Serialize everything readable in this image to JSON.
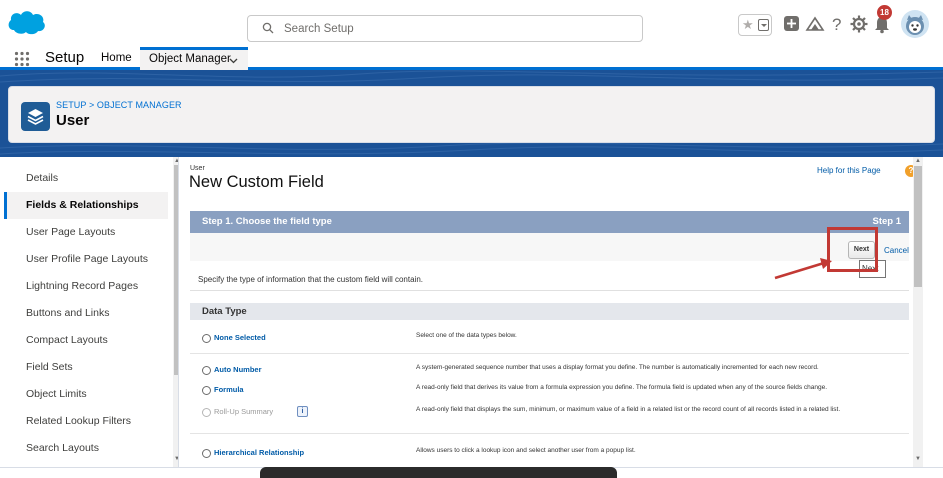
{
  "header": {
    "search": {
      "placeholder": "Search Setup"
    },
    "notification_count": "18",
    "colors": {
      "brand": "#00a1e0",
      "accent": "#0070d2",
      "badge": "#c23934"
    },
    "icons": [
      "salesforce-logo-icon",
      "star-icon",
      "add-icon",
      "trailhead-icon",
      "help-icon",
      "gear-icon",
      "bell-icon",
      "avatar-icon"
    ]
  },
  "app_nav": {
    "app_name": "Setup",
    "home": "Home",
    "object_manager": "Object Manager"
  },
  "page_header": {
    "breadcrumb": "SETUP > OBJECT MANAGER",
    "title": "User"
  },
  "sidebar": {
    "items": [
      {
        "label": "Details"
      },
      {
        "label": "Fields & Relationships",
        "active": true
      },
      {
        "label": "User Page Layouts"
      },
      {
        "label": "User Profile Page Layouts"
      },
      {
        "label": "Lightning Record Pages"
      },
      {
        "label": "Buttons and Links"
      },
      {
        "label": "Compact Layouts"
      },
      {
        "label": "Field Sets"
      },
      {
        "label": "Object Limits"
      },
      {
        "label": "Related Lookup Filters"
      },
      {
        "label": "Search Layouts"
      }
    ]
  },
  "main": {
    "entity": "User",
    "title": "New Custom Field",
    "help_link": "Help for this Page",
    "step": {
      "title": "Step 1. Choose the field type",
      "number": "Step 1"
    },
    "buttons": {
      "next": "Next",
      "cancel": "Cancel",
      "tooltip": "Next"
    },
    "instruction": "Specify the type of information that the custom field will contain.",
    "data_type_header": "Data Type",
    "types": [
      {
        "label": "None Selected",
        "description": "Select one of the data types below."
      },
      {
        "label": "Auto Number",
        "description": "A system-generated sequence number that uses a display format you define. The number is automatically incremented for each new record."
      },
      {
        "label": "Formula",
        "description": "A read-only field that derives its value from a formula expression you define. The formula field is updated when any of the source fields change."
      },
      {
        "label": "Roll-Up Summary",
        "description": "A read-only field that displays the sum, minimum, or maximum value of a field in a related list or the record count of all records listed in a related list.",
        "disabled": true
      },
      {
        "label": "Hierarchical Relationship",
        "description": "Allows users to click a lookup icon and select another user from a popup list."
      }
    ]
  }
}
